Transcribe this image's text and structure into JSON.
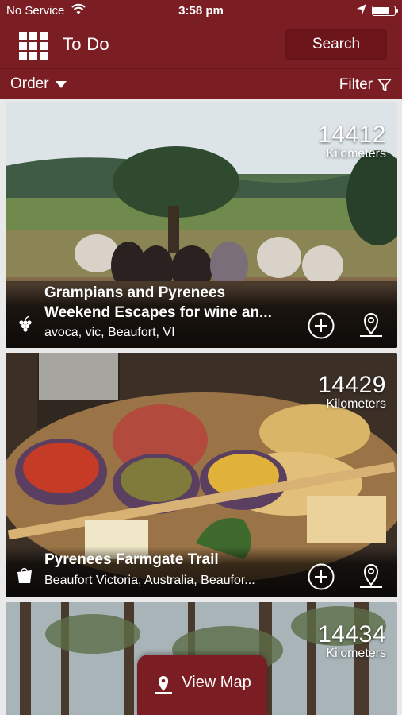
{
  "status_bar": {
    "carrier": "No Service",
    "time": "3:58 pm"
  },
  "header": {
    "title": "To Do",
    "search_label": "Search"
  },
  "subbar": {
    "order_label": "Order",
    "filter_label": "Filter"
  },
  "cards": [
    {
      "distance": "14412",
      "unit": "Kilometers",
      "title_line1": "Grampians and Pyrenees",
      "title_line2": "Weekend Escapes for wine an...",
      "subtitle": "avoca, vic, Beaufort, VI",
      "category_icon": "grapes-icon"
    },
    {
      "distance": "14429",
      "unit": "Kilometers",
      "title_line1": "Pyrenees Farmgate Trail",
      "subtitle": "Beaufort Victoria, Australia, Beaufor...",
      "category_icon": "shopping-bag-icon"
    },
    {
      "distance": "14434",
      "unit": "Kilometers"
    }
  ],
  "view_map_label": "View Map",
  "colors": {
    "brand": "#7b1e24",
    "brand_dark": "#6c161c"
  }
}
